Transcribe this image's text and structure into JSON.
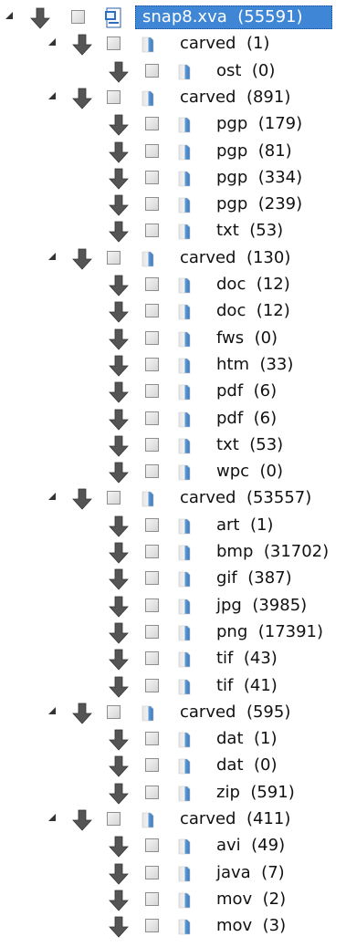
{
  "tree": {
    "root": {
      "label": "snap8.xva",
      "count": "(55591)",
      "icon": "xva-file-icon"
    },
    "groups": [
      {
        "label": "carved",
        "count": "(1)",
        "children": [
          {
            "label": "ost",
            "count": "(0)"
          }
        ]
      },
      {
        "label": "carved",
        "count": "(891)",
        "children": [
          {
            "label": "pgp",
            "count": "(179)"
          },
          {
            "label": "pgp",
            "count": "(81)"
          },
          {
            "label": "pgp",
            "count": "(334)"
          },
          {
            "label": "pgp",
            "count": "(239)"
          },
          {
            "label": "txt",
            "count": "(53)"
          }
        ]
      },
      {
        "label": "carved",
        "count": "(130)",
        "children": [
          {
            "label": "doc",
            "count": "(12)"
          },
          {
            "label": "doc",
            "count": "(12)"
          },
          {
            "label": "fws",
            "count": "(0)"
          },
          {
            "label": "htm",
            "count": "(33)"
          },
          {
            "label": "pdf",
            "count": "(6)"
          },
          {
            "label": "pdf",
            "count": "(6)"
          },
          {
            "label": "txt",
            "count": "(53)"
          },
          {
            "label": "wpc",
            "count": "(0)"
          }
        ]
      },
      {
        "label": "carved",
        "count": "(53557)",
        "children": [
          {
            "label": "art",
            "count": "(1)"
          },
          {
            "label": "bmp",
            "count": "(31702)"
          },
          {
            "label": "gif",
            "count": "(387)"
          },
          {
            "label": "jpg",
            "count": "(3985)"
          },
          {
            "label": "png",
            "count": "(17391)"
          },
          {
            "label": "tif",
            "count": "(43)"
          },
          {
            "label": "tif",
            "count": "(41)"
          }
        ]
      },
      {
        "label": "carved",
        "count": "(595)",
        "children": [
          {
            "label": "dat",
            "count": "(1)"
          },
          {
            "label": "dat",
            "count": "(0)"
          },
          {
            "label": "zip",
            "count": "(591)"
          }
        ]
      },
      {
        "label": "carved",
        "count": "(411)",
        "children": [
          {
            "label": "avi",
            "count": "(49)"
          },
          {
            "label": "java",
            "count": "(7)"
          },
          {
            "label": "mov",
            "count": "(2)"
          },
          {
            "label": "mov",
            "count": "(3)"
          }
        ]
      }
    ]
  },
  "icons": {
    "expander": "collapse-triangle-icon",
    "arrow": "down-arrow-icon",
    "checkbox": "checkbox-icon",
    "file": "file-icon"
  },
  "colors": {
    "selection": "#3f87d6",
    "arrow": "#555555",
    "file_icon_blue": "#5f9bd6"
  }
}
